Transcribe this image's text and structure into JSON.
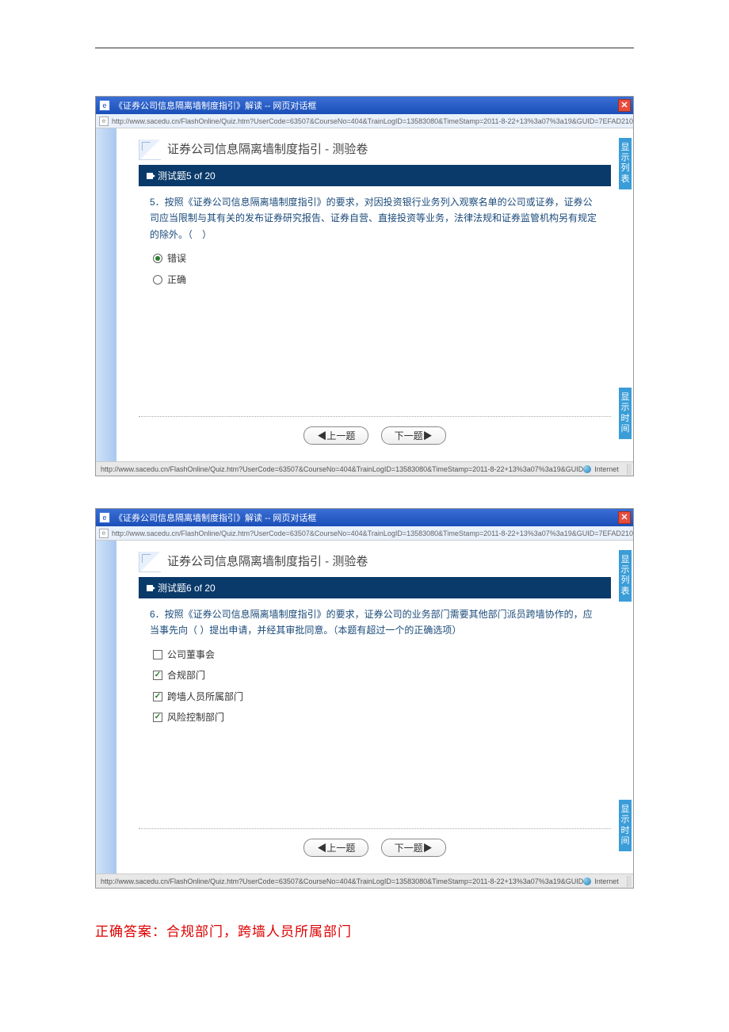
{
  "window": {
    "title": "《证券公司信息隔离墙制度指引》解读 -- 网页对话框",
    "url": "http://www.sacedu.cn/FlashOnline/Quiz.htm?UserCode=63507&CourseNo=404&TrainLogID=13583080&TimeStamp=2011-8-22+13%3a07%3a19&GUID=7EFAD210-989B-48CD-8820-EB4B19C5F9B4&HIIP=http%3a%2f%2",
    "status_url": "http://www.sacedu.cn/FlashOnline/Quiz.htm?UserCode=63507&CourseNo=404&TrainLogID=13583080&TimeStamp=2011-8-22+13%3a07%3a19&GUID",
    "zone": "Internet"
  },
  "quiz": {
    "title": "证券公司信息隔离墙制度指引 - 测验卷"
  },
  "side_tabs": {
    "list": "显示列表",
    "time": "显示时间"
  },
  "nav": {
    "prev": "◀上一题",
    "next": "下一题▶"
  },
  "q5": {
    "header": "测试题5 of 20",
    "text": "5．按照《证券公司信息隔离墙制度指引》的要求，对因投资银行业务列入观察名单的公司或证券，证券公司应当限制与其有关的发布证券研究报告、证券自营、直接投资等业务，法律法规和证券监管机构另有规定的除外。（　）",
    "opt_wrong": "错误",
    "opt_right": "正确"
  },
  "q6": {
    "header": "测试题6 of 20",
    "text": "6．按照《证券公司信息隔离墙制度指引》的要求，证券公司的业务部门需要其他部门派员跨墙协作的，应当事先向（ ）提出申请，并经其审批同意。（本题有超过一个的正确选项）",
    "opt_a": "公司董事会",
    "opt_b": "合规部门",
    "opt_c": "跨墙人员所属部门",
    "opt_d": "风险控制部门"
  },
  "answer": "正确答案：合规部门，跨墙人员所属部门"
}
